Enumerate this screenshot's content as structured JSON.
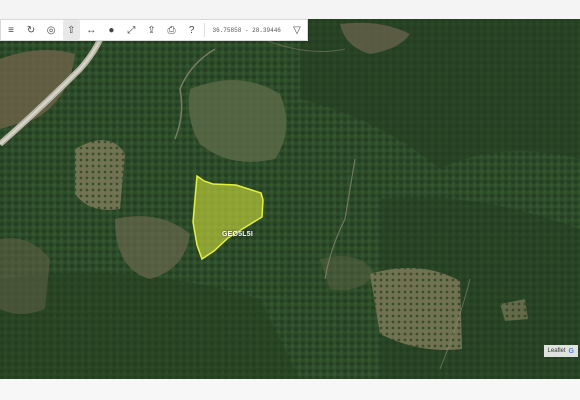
{
  "toolbar": {
    "buttons": [
      {
        "name": "layers-icon",
        "glyph": "≡"
      },
      {
        "name": "refresh-icon",
        "glyph": "↻"
      },
      {
        "name": "locate-icon",
        "glyph": "◎"
      },
      {
        "name": "pan-icon",
        "glyph": "⇧"
      },
      {
        "name": "measure-line-icon",
        "glyph": "↔"
      },
      {
        "name": "draw-point-icon",
        "glyph": "●"
      },
      {
        "name": "fit-extent-icon",
        "glyph": "⤢"
      },
      {
        "name": "upload-icon",
        "glyph": "⇪"
      },
      {
        "name": "print-icon",
        "glyph": "⎙"
      },
      {
        "name": "help-icon",
        "glyph": "?"
      }
    ],
    "coords": "36.75858 - 28.39446",
    "menu_glyph": "▽"
  },
  "parcel": {
    "label": "GEØ5L5I",
    "fill_color": "#c9d83a",
    "stroke_color": "#e4f041"
  },
  "attribution": {
    "leaflet": "Leaflet",
    "google": "G"
  }
}
